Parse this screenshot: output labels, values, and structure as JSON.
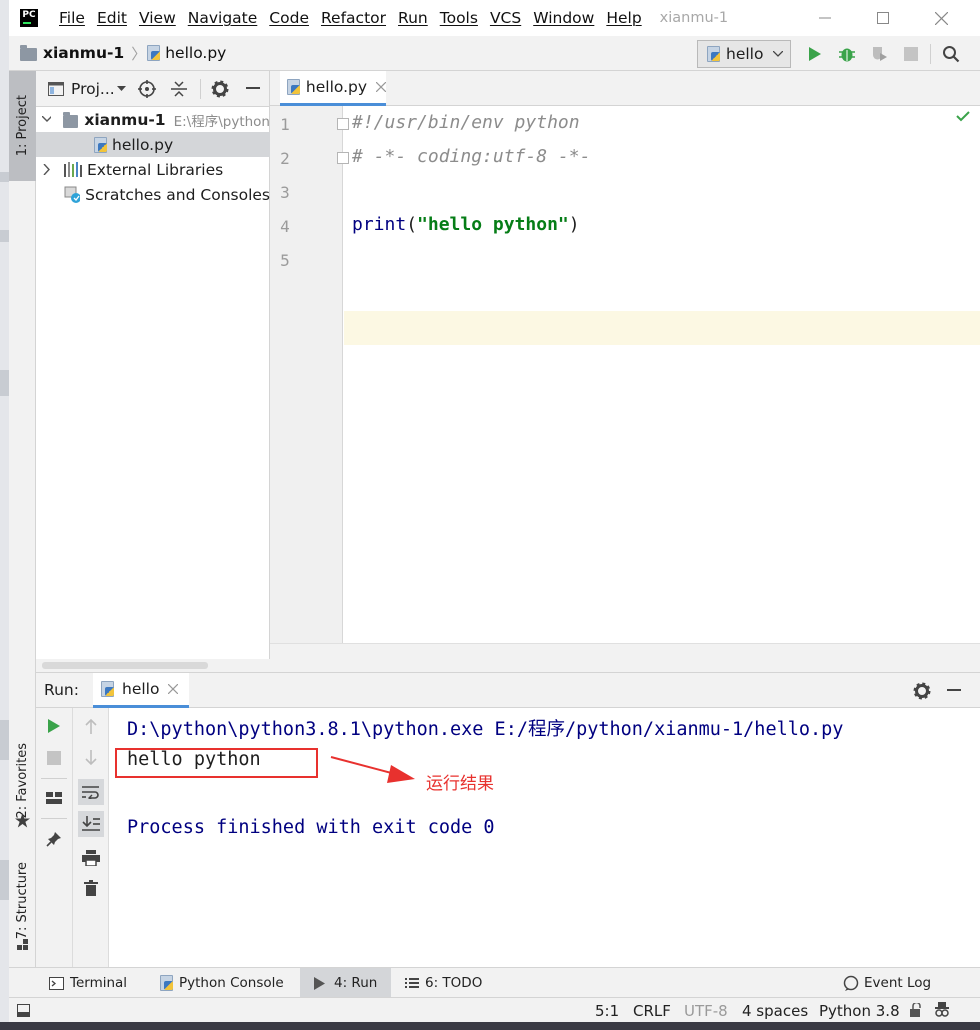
{
  "window": {
    "title": "xianmu-1",
    "menu": [
      "File",
      "Edit",
      "View",
      "Navigate",
      "Code",
      "Refactor",
      "Run",
      "Tools",
      "VCS",
      "Window",
      "Help"
    ],
    "logo_text": "PC"
  },
  "navbar": {
    "project": "xianmu-1",
    "file": "hello.py",
    "run_config": "hello"
  },
  "side_tabs": {
    "project": "1: Project",
    "favorites": "2: Favorites",
    "structure": "7: Structure"
  },
  "project_panel": {
    "header": "Proj...",
    "tree": [
      {
        "label": "xianmu-1",
        "path": "E:\\程序\\python"
      },
      {
        "label": "hello.py"
      },
      {
        "label": "External Libraries"
      },
      {
        "label": "Scratches and Consoles"
      }
    ]
  },
  "editor": {
    "tab": "hello.py",
    "line_numbers": [
      "1",
      "2",
      "3",
      "4",
      "5"
    ],
    "code": {
      "line1": "#!/usr/bin/env python",
      "line2": "# -*- coding:utf-8 -*-",
      "line4_fn": "print",
      "line4_open": "(",
      "line4_str": "\"hello python\"",
      "line4_close": ")"
    }
  },
  "run_panel": {
    "label": "Run:",
    "tab": "hello",
    "output": {
      "command": "D:\\python\\python3.8.1\\python.exe E:/程序/python/xianmu-1/hello.py",
      "result": "hello python",
      "finished": "Process finished with exit code 0"
    },
    "annotation": "运行结果",
    "annotation_color": "#e8312e"
  },
  "bottom_tabs": {
    "terminal": "Terminal",
    "python_console": "Python Console",
    "run": "4: Run",
    "todo": "6: TODO",
    "event_log": "Event Log"
  },
  "status": {
    "position": "5:1",
    "line_sep": "CRLF",
    "encoding": "UTF-8",
    "indent": "4 spaces",
    "interpreter": "Python 3.8"
  }
}
